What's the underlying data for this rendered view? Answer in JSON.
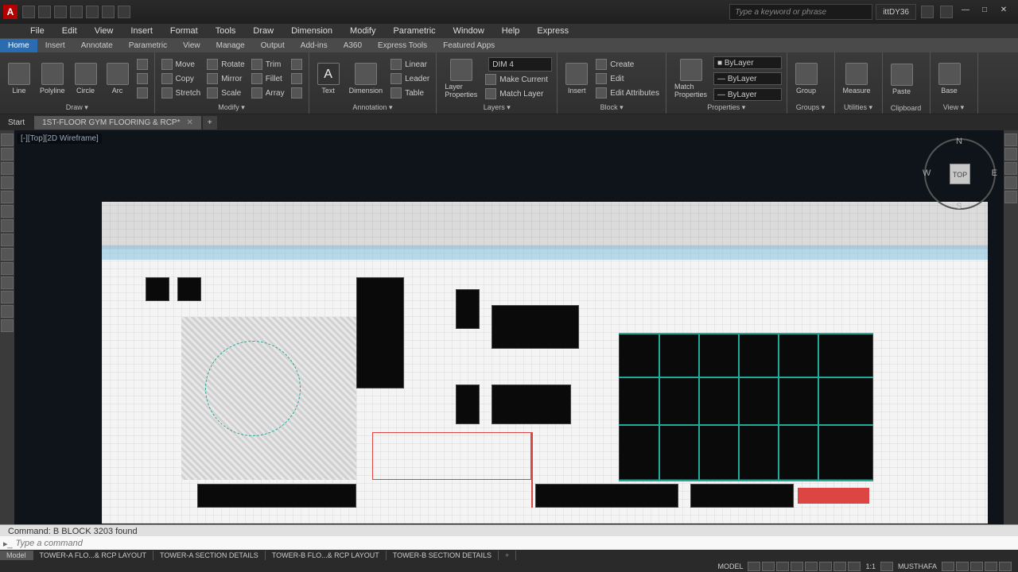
{
  "titlebar": {
    "logo": "A",
    "search_placeholder": "Type a keyword or phrase",
    "username": "ittDY36"
  },
  "menu": {
    "items": [
      "File",
      "Edit",
      "View",
      "Insert",
      "Format",
      "Tools",
      "Draw",
      "Dimension",
      "Modify",
      "Parametric",
      "Window",
      "Help",
      "Express"
    ]
  },
  "ribbon_tabs": [
    "Home",
    "Insert",
    "Annotate",
    "Parametric",
    "View",
    "Manage",
    "Output",
    "Add-ins",
    "A360",
    "Express Tools",
    "Featured Apps"
  ],
  "ribbon": {
    "draw": {
      "title": "Draw",
      "line": "Line",
      "polyline": "Polyline",
      "circle": "Circle",
      "arc": "Arc"
    },
    "modify": {
      "title": "Modify",
      "move": "Move",
      "copy": "Copy",
      "stretch": "Stretch",
      "rotate": "Rotate",
      "mirror": "Mirror",
      "scale": "Scale",
      "trim": "Trim",
      "fillet": "Fillet",
      "array": "Array"
    },
    "annotation": {
      "title": "Annotation",
      "text": "Text",
      "dimension": "Dimension",
      "linear": "Linear",
      "leader": "Leader",
      "table": "Table"
    },
    "layers": {
      "title": "Layers",
      "layer_props": "Layer\nProperties",
      "current": "DIM 4",
      "make_current": "Make Current",
      "match_layer": "Match Layer"
    },
    "block": {
      "title": "Block",
      "insert": "Insert",
      "create": "Create",
      "edit": "Edit",
      "edit_attr": "Edit Attributes"
    },
    "properties": {
      "title": "Properties",
      "match": "Match\nProperties",
      "bylayer": "ByLayer"
    },
    "groups": {
      "title": "Groups",
      "group": "Group"
    },
    "utilities": {
      "title": "Utilities",
      "measure": "Measure"
    },
    "clipboard": {
      "title": "Clipboard",
      "paste": "Paste"
    },
    "view": {
      "title": "View",
      "base": "Base"
    }
  },
  "filetabs": {
    "start": "Start",
    "active": "1ST-FLOOR GYM FLOORING & RCP*"
  },
  "viewport_label": "[-][Top][2D Wireframe]",
  "viewcube": {
    "top": "TOP",
    "n": "N",
    "s": "S",
    "e": "E",
    "w": "W"
  },
  "command": {
    "history": "Command: B BLOCK 3203 found",
    "placeholder": "Type a command"
  },
  "layout_tabs": [
    "Model",
    "TOWER-A  FLO...& RCP LAYOUT",
    "TOWER-A SECTION DETAILS",
    "TOWER-B  FLO...& RCP LAYOUT",
    "TOWER-B SECTION DETAILS"
  ],
  "status": {
    "model": "MODEL",
    "scale": "1:1",
    "user": "MUSTHAFA"
  }
}
